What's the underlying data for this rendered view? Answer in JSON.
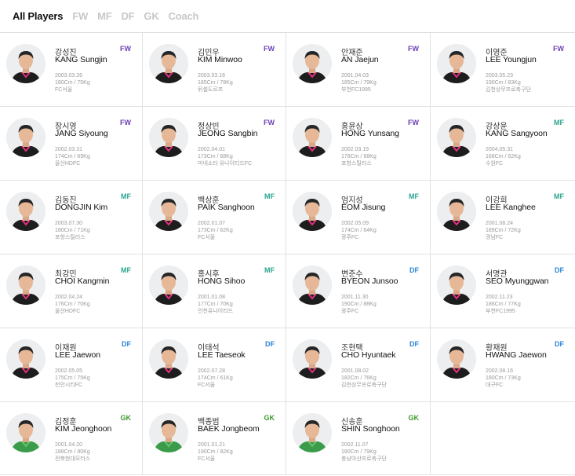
{
  "tabs": [
    {
      "label": "All Players",
      "active": true
    },
    {
      "label": "FW",
      "active": false
    },
    {
      "label": "MF",
      "active": false
    },
    {
      "label": "DF",
      "active": false
    },
    {
      "label": "GK",
      "active": false
    },
    {
      "label": "Coach",
      "active": false
    }
  ],
  "colors": {
    "FW": "#6a3fb5",
    "MF": "#2ba58f",
    "DF": "#2a84d6",
    "GK": "#3c9a2c",
    "active_tab": "#111111",
    "inactive_tab": "#c8c8c8"
  },
  "players": [
    {
      "kname": "강성진",
      "ename": "KANG Sungjin",
      "pos": "FW",
      "birth": "2003.03.26",
      "body": "180Cm / 75Kg",
      "club": "FC서울"
    },
    {
      "kname": "김민우",
      "ename": "KIM Minwoo",
      "pos": "FW",
      "birth": "2003.03.16",
      "body": "185Cm / 78Kg",
      "club": "뒤셀도르프"
    },
    {
      "kname": "안재준",
      "ename": "AN Jaejun",
      "pos": "FW",
      "birth": "2001.04.03",
      "body": "185Cm / 79Kg",
      "club": "부천FC1995"
    },
    {
      "kname": "이영준",
      "ename": "LEE Youngjun",
      "pos": "FW",
      "birth": "2003.05.23",
      "body": "190Cm / 83Kg",
      "club": "김천상무프로축구단"
    },
    {
      "kname": "장시영",
      "ename": "JANG Siyoung",
      "pos": "FW",
      "birth": "2002.03.31",
      "body": "174Cm / 69Kg",
      "club": "울산HDFC"
    },
    {
      "kname": "정상빈",
      "ename": "JEONG Sangbin",
      "pos": "FW",
      "birth": "2002.04.01",
      "body": "173Cm / 68Kg",
      "club": "미네소타 유나이티드FC"
    },
    {
      "kname": "홍윤상",
      "ename": "HONG Yunsang",
      "pos": "FW",
      "birth": "2002.03.19",
      "body": "178Cm / 68Kg",
      "club": "포항스틸러스"
    },
    {
      "kname": "강상윤",
      "ename": "KANG Sangyoon",
      "pos": "MF",
      "birth": "2004.05.31",
      "body": "168Cm / 62Kg",
      "club": "수원FC"
    },
    {
      "kname": "김동진",
      "ename": "DONGJIN Kim",
      "pos": "MF",
      "birth": "2003.07.30",
      "body": "180Cm / 71Kg",
      "club": "포항스틸러스"
    },
    {
      "kname": "백상훈",
      "ename": "PAIK Sanghoon",
      "pos": "MF",
      "birth": "2002.01.07",
      "body": "173Cm / 62Kg",
      "club": "FC서울"
    },
    {
      "kname": "엄지성",
      "ename": "EOM Jisung",
      "pos": "MF",
      "birth": "2002.05.09",
      "body": "174Cm / 64Kg",
      "club": "광주FC"
    },
    {
      "kname": "이강희",
      "ename": "LEE Kanghee",
      "pos": "MF",
      "birth": "2001.08.24",
      "body": "189Cm / 72Kg",
      "club": "경남FC"
    },
    {
      "kname": "최강민",
      "ename": "CHOI Kangmin",
      "pos": "MF",
      "birth": "2002.04.24",
      "body": "176Cm / 70Kg",
      "club": "울산HDFC"
    },
    {
      "kname": "홍시후",
      "ename": "HONG Sihoo",
      "pos": "MF",
      "birth": "2001.01.08",
      "body": "177Cm / 70Kg",
      "club": "인천유나이티드"
    },
    {
      "kname": "변준수",
      "ename": "BYEON Junsoo",
      "pos": "DF",
      "birth": "2001.11.30",
      "body": "190Cm / 88Kg",
      "club": "광주FC"
    },
    {
      "kname": "서명관",
      "ename": "SEO Myunggwan",
      "pos": "DF",
      "birth": "2002.11.23",
      "body": "186Cm / 77Kg",
      "club": "부천FC1995"
    },
    {
      "kname": "이재원",
      "ename": "LEE Jaewon",
      "pos": "DF",
      "birth": "2002.05.05",
      "body": "175Cm / 75Kg",
      "club": "천안시티FC"
    },
    {
      "kname": "이태석",
      "ename": "LEE Taeseok",
      "pos": "DF",
      "birth": "2002.07.28",
      "body": "174Cm / 61Kg",
      "club": "FC서울"
    },
    {
      "kname": "조현택",
      "ename": "CHO Hyuntaek",
      "pos": "DF",
      "birth": "2001.08.02",
      "body": "182Cm / 76Kg",
      "club": "김천상무프로축구단"
    },
    {
      "kname": "황재원",
      "ename": "HWANG Jaewon",
      "pos": "DF",
      "birth": "2002.08.16",
      "body": "180Cm / 73Kg",
      "club": "대구FC"
    },
    {
      "kname": "김정훈",
      "ename": "KIM Jeonghoon",
      "pos": "GK",
      "birth": "2001.04.20",
      "body": "188Cm / 80Kg",
      "club": "전북현대모터스"
    },
    {
      "kname": "백종범",
      "ename": "BAEK Jongbeom",
      "pos": "GK",
      "birth": "2001.01.21",
      "body": "190Cm / 82Kg",
      "club": "FC서울"
    },
    {
      "kname": "신송훈",
      "ename": "SHIN Songhoon",
      "pos": "GK",
      "birth": "2002.11.07",
      "body": "180Cm / 79Kg",
      "club": "충남아산프로축구단"
    }
  ]
}
